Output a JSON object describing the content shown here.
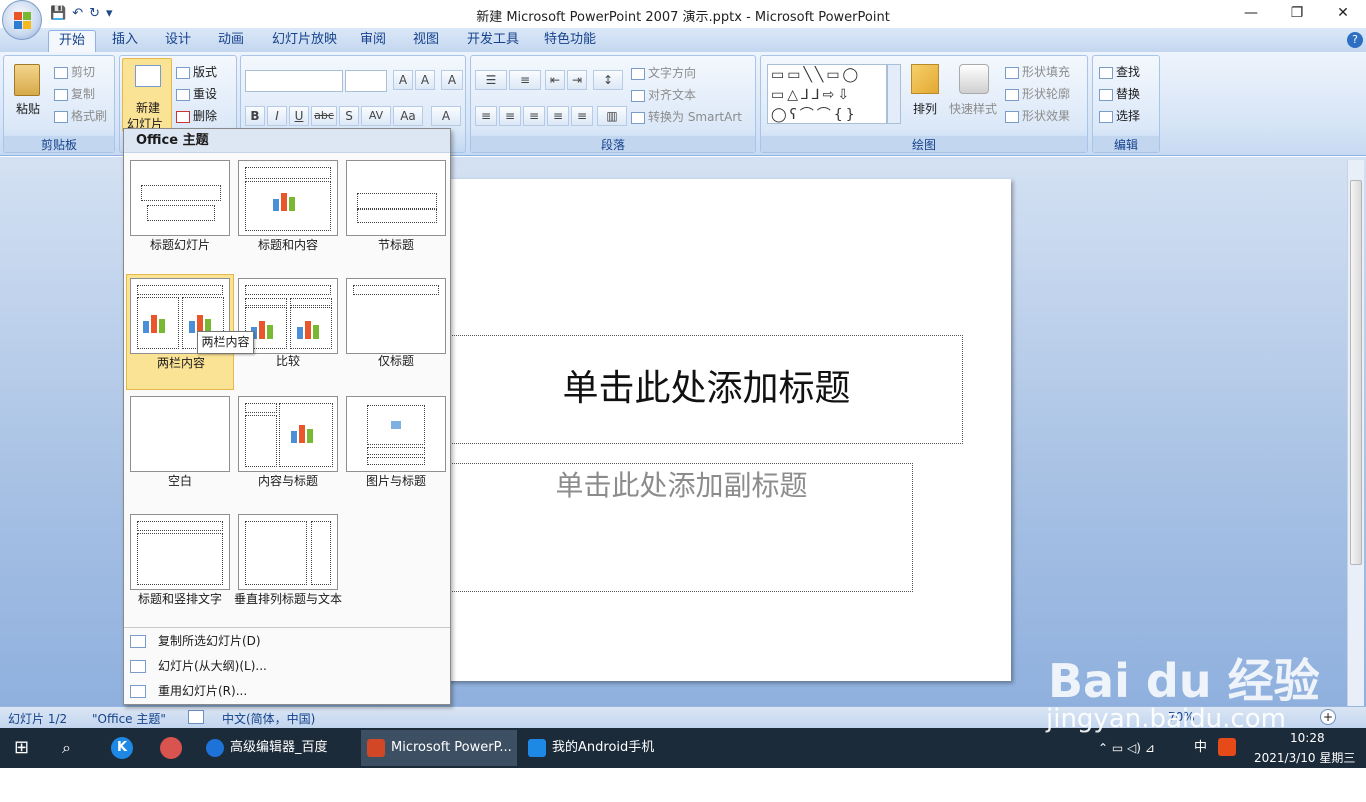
{
  "window": {
    "title": "新建 Microsoft PowerPoint 2007 演示.pptx - Microsoft PowerPoint",
    "controls": {
      "minimize": "—",
      "restore": "❐",
      "close": "✕"
    }
  },
  "qat": {
    "save": "💾",
    "undo": "↶",
    "redo": "↻",
    "more": "▾"
  },
  "tabs": [
    "开始",
    "插入",
    "设计",
    "动画",
    "幻灯片放映",
    "审阅",
    "视图",
    "开发工具",
    "特色功能"
  ],
  "ribbon": {
    "clipboard": {
      "paste": "粘贴",
      "cut": "剪切",
      "copy": "复制",
      "format_painter": "格式刷",
      "label": "剪贴板"
    },
    "slides": {
      "new_slide_1": "新建",
      "new_slide_2": "幻灯片",
      "layout": "版式",
      "reset": "重设",
      "delete": "删除"
    },
    "font": {
      "bold": "B",
      "italic": "I",
      "underline": "U",
      "strike": "abc",
      "shadow": "S",
      "spacing": "AV",
      "case": "Aa",
      "grow": "A",
      "shrink": "A",
      "clear": "A",
      "color": "A"
    },
    "paragraph": {
      "text_direction": "文字方向",
      "align_text": "对齐文本",
      "smartart": "转换为 SmartArt",
      "label": "段落"
    },
    "drawing": {
      "arrange": "排列",
      "quick_styles": "快速样式",
      "shape_fill": "形状填充",
      "shape_outline": "形状轮廓",
      "shape_effects": "形状效果",
      "label": "绘图"
    },
    "editing": {
      "find": "查找",
      "replace": "替换",
      "select": "选择",
      "label": "编辑"
    }
  },
  "gallery": {
    "header": "Office 主题",
    "layouts": [
      "标题幻灯片",
      "标题和内容",
      "节标题",
      "两栏内容",
      "比较",
      "仅标题",
      "空白",
      "内容与标题",
      "图片与标题",
      "标题和竖排文字",
      "垂直排列标题与文本"
    ],
    "selected": "两栏内容",
    "tooltip": "两栏内容",
    "menu": [
      "复制所选幻灯片(D)",
      "幻灯片(从大纲)(L)...",
      "重用幻灯片(R)..."
    ]
  },
  "slide": {
    "title_placeholder": "单击此处添加标题",
    "subtitle_placeholder": "单击此处添加副标题"
  },
  "statusbar": {
    "slide_count": "幻灯片 1/2",
    "theme": "\"Office 主题\"",
    "language": "中文(简体，中国)",
    "zoom": "70%"
  },
  "taskbar": {
    "apps": [
      "高级编辑器_百度经...",
      "Microsoft PowerP...",
      "我的Android手机"
    ],
    "time": "10:28",
    "date": "2021/3/10 星期三",
    "ime": "中"
  },
  "watermark": {
    "brand": "Bai du 经验",
    "url": "jingyan.baidu.com"
  },
  "colors": {
    "ribbon_text": "#15428b",
    "selection": "#fbe396",
    "taskbar": "#1c2b3a"
  }
}
